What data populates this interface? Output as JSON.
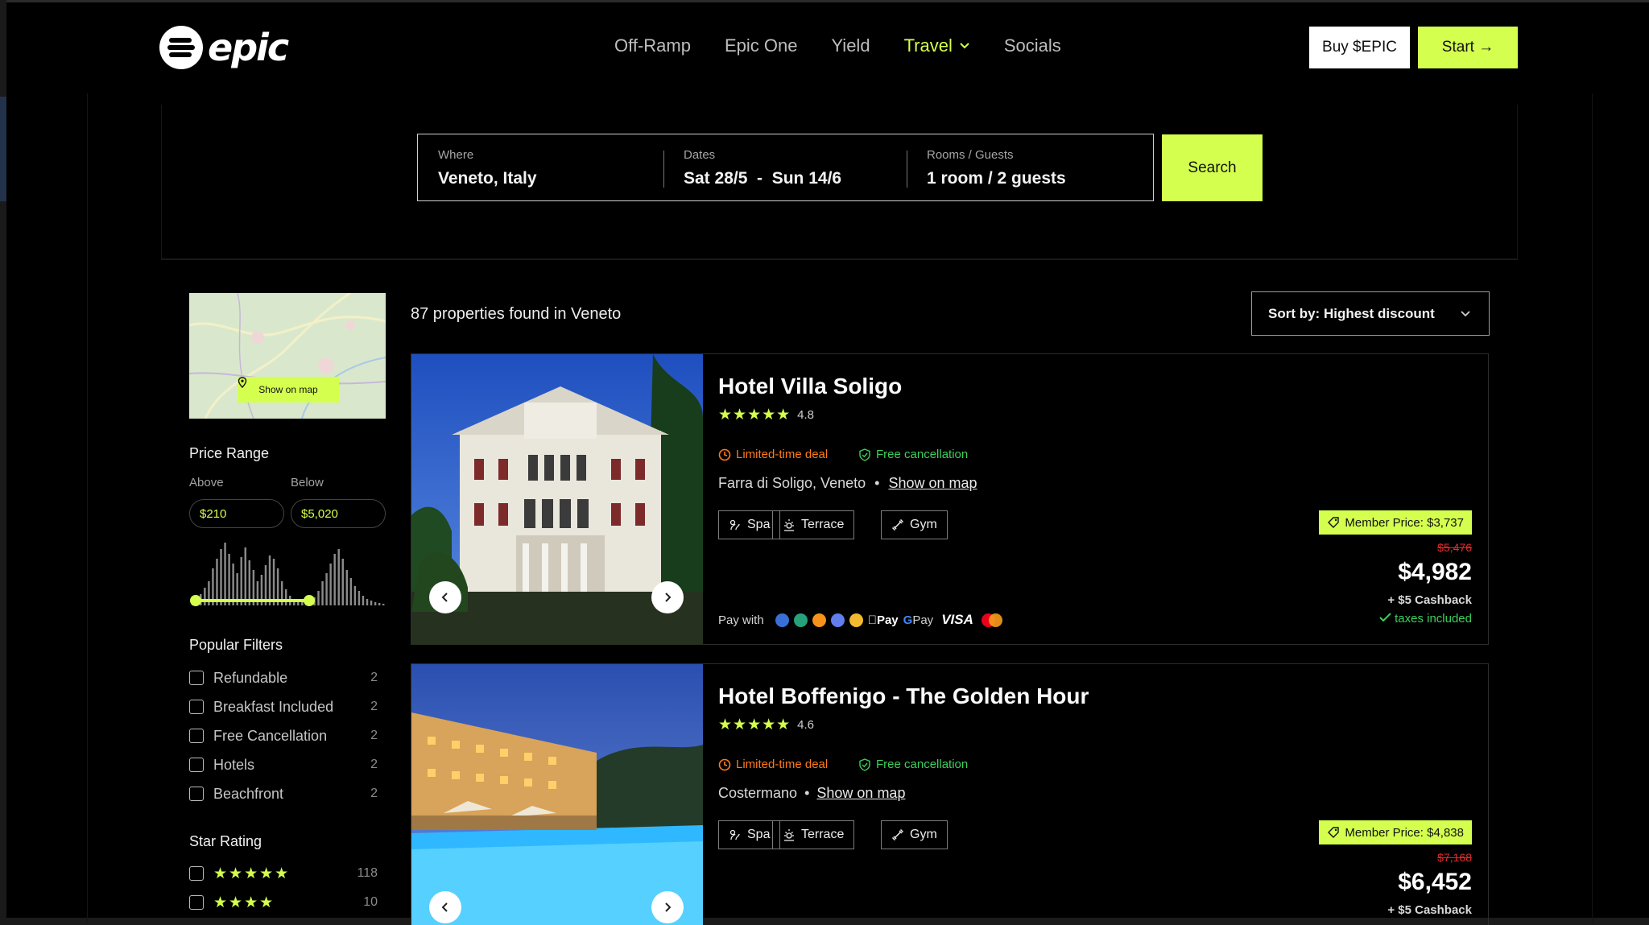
{
  "brand": {
    "name": "epic"
  },
  "nav": {
    "items": [
      {
        "label": "Off-Ramp"
      },
      {
        "label": "Epic One"
      },
      {
        "label": "Yield"
      },
      {
        "label": "Travel",
        "active": true
      },
      {
        "label": "Socials"
      }
    ]
  },
  "header": {
    "buy_label": "Buy $EPIC",
    "start_label": "Start →"
  },
  "search": {
    "where_label": "Where",
    "where_value": "Veneto, Italy",
    "dates_label": "Dates",
    "dates_value": "Sat 28/5  -  Sun 14/6",
    "rooms_label": "Rooms / Guests",
    "rooms_value": "1 room / 2 guests",
    "button_label": "Search"
  },
  "sidebar": {
    "map_button": "Show on map",
    "price_range": {
      "title": "Price Range",
      "above_label": "Above",
      "below_label": "Below",
      "min": "$210",
      "max": "$5,020"
    },
    "popular_title": "Popular Filters",
    "filters": [
      {
        "label": "Refundable",
        "count": "2"
      },
      {
        "label": "Breakfast Included",
        "count": "2"
      },
      {
        "label": "Free Cancellation",
        "count": "2"
      },
      {
        "label": "Hotels",
        "count": "2"
      },
      {
        "label": "Beachfront",
        "count": "2"
      }
    ],
    "star_title": "Star Rating",
    "star_filters": [
      {
        "stars": "★★★★★",
        "count": "118"
      },
      {
        "stars": "★★★★",
        "count": "10"
      }
    ]
  },
  "results": {
    "count_text": "87 properties found in Veneto",
    "sort_label": "Sort by: Highest discount"
  },
  "hotels": [
    {
      "name": "Hotel Villa Soligo",
      "stars": "★★★★★",
      "rating": "4.8",
      "deal": "Limited-time deal",
      "cancellation": "Free cancellation",
      "location": "Farra di Soligo, Veneto",
      "location_sep": "•",
      "map_link": "Show on map",
      "amenities": [
        "Spa",
        "Terrace",
        "Gym"
      ],
      "member_price": "Member Price: $3,737",
      "old_price": "$5,476",
      "price": "$4,982",
      "cashback": "+ $5 Cashback",
      "taxes": "taxes included",
      "pay_with": "Pay with",
      "pay_apple": "Pay",
      "pay_google": "Pay",
      "pay_visa": "VISA"
    },
    {
      "name": "Hotel Boffenigo - The Golden Hour",
      "stars": "★★★★★",
      "rating": "4.6",
      "deal": "Limited-time deal",
      "cancellation": "Free cancellation",
      "location": "Costermano",
      "location_sep": "•",
      "map_link": "Show on map",
      "amenities": [
        "Spa",
        "Terrace",
        "Gym"
      ],
      "member_price": "Member Price: $4,838",
      "old_price": "$7,168",
      "price": "$6,452",
      "cashback": "+ $5 Cashback"
    }
  ],
  "colors": {
    "accent": "#d4ff4e",
    "deal": "#ff7a1a",
    "success": "#3ccf5c",
    "strike": "#e12b2b"
  }
}
